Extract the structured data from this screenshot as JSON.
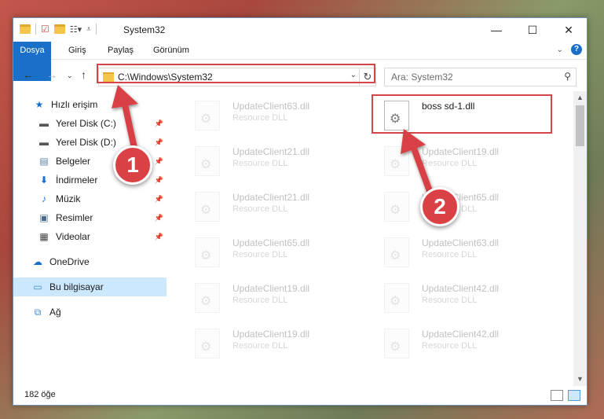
{
  "window": {
    "title": "System32"
  },
  "ribbon": {
    "tabs": [
      "Dosya",
      "Giriş",
      "Paylaş",
      "Görünüm"
    ]
  },
  "address": {
    "path": "C:\\Windows\\System32"
  },
  "search": {
    "placeholder": "Ara: System32"
  },
  "sidebar": {
    "items": [
      {
        "label": "Hızlı erişim",
        "icon": "star-icon"
      },
      {
        "label": "Yerel Disk (C:)",
        "icon": "drive-icon",
        "pinned": true
      },
      {
        "label": "Yerel Disk (D:)",
        "icon": "drive-icon",
        "pinned": true
      },
      {
        "label": "Belgeler",
        "icon": "documents-icon",
        "pinned": true
      },
      {
        "label": "İndirmeler",
        "icon": "downloads-icon",
        "pinned": true
      },
      {
        "label": "Müzik",
        "icon": "music-icon",
        "pinned": true
      },
      {
        "label": "Resimler",
        "icon": "pictures-icon",
        "pinned": true
      },
      {
        "label": "Videolar",
        "icon": "videos-icon",
        "pinned": true
      },
      {
        "label": "OneDrive",
        "icon": "cloud-icon"
      },
      {
        "label": "Bu bilgisayar",
        "icon": "computer-icon",
        "selected": true
      },
      {
        "label": "Ağ",
        "icon": "network-icon"
      }
    ]
  },
  "files": {
    "left": [
      {
        "name": "UpdateClient63.dll",
        "type": "Resource DLL"
      },
      {
        "name": "UpdateClient21.dll",
        "type": "Resource DLL"
      },
      {
        "name": "UpdateClient21.dll",
        "type": "Resource DLL"
      },
      {
        "name": "UpdateClient65.dll",
        "type": "Resource DLL"
      },
      {
        "name": "UpdateClient19.dll",
        "type": "Resource DLL"
      },
      {
        "name": "UpdateClient19.dll",
        "type": "Resource DLL"
      }
    ],
    "right": [
      {
        "name": "boss sd-1.dll",
        "type": ""
      },
      {
        "name": "UpdateClient19.dll",
        "type": "Resource DLL"
      },
      {
        "name": "UpdateClient65.dll",
        "type": "Resource DLL"
      },
      {
        "name": "UpdateClient63.dll",
        "type": "Resource DLL"
      },
      {
        "name": "UpdateClient42.dll",
        "type": "Resource DLL"
      },
      {
        "name": "UpdateClient42.dll",
        "type": "Resource DLL"
      }
    ]
  },
  "status": {
    "count": "182 öğe"
  },
  "annotations": {
    "step1": "1",
    "step2": "2"
  },
  "colors": {
    "accent": "#1a6fc9",
    "highlight": "#d4454a",
    "selected": "#cce8ff"
  }
}
